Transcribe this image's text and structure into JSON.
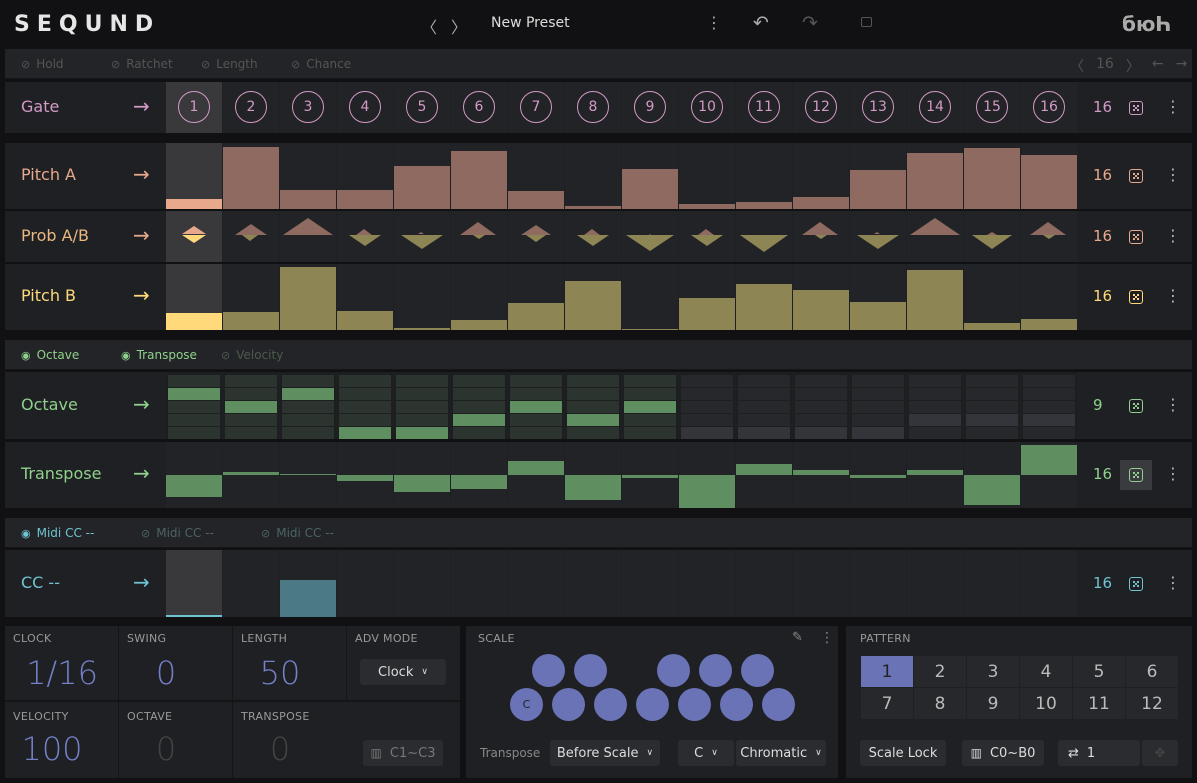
{
  "header": {
    "logo": "SEQUND",
    "prev_icon": "chevron-left-icon",
    "next_icon": "chevron-right-icon",
    "preset": "New Preset",
    "brand": "бюҺ"
  },
  "colors": {
    "gate": "#d39ac6",
    "pitch_a": "#e8a88c",
    "pitch_a_bar": "#8f6a60",
    "pitch_b": "#ffd97a",
    "pitch_b_bar": "#8e8555",
    "green": "#8fd18c",
    "green_bar": "#5f8e61",
    "cc": "#6fc4d2",
    "cc_bar": "#4b7a86",
    "accent": "#6a73b6"
  },
  "section1": {
    "tabs": [
      {
        "label": "Hold",
        "visible": false
      },
      {
        "label": "Ratchet",
        "visible": false
      },
      {
        "label": "Length",
        "visible": false
      },
      {
        "label": "Chance",
        "visible": false
      }
    ],
    "nav": {
      "length": "16"
    }
  },
  "gate": {
    "label": "Gate",
    "count": "16",
    "steps": [
      "1",
      "2",
      "3",
      "4",
      "5",
      "6",
      "7",
      "8",
      "9",
      "10",
      "11",
      "12",
      "13",
      "14",
      "15",
      "16"
    ]
  },
  "pitch_a": {
    "label": "Pitch A",
    "count": "16",
    "values": [
      15,
      94,
      29,
      29,
      65,
      88,
      27,
      5,
      61,
      8,
      11,
      18,
      59,
      85,
      92,
      82
    ]
  },
  "prob_ab": {
    "label": "Prob A/B",
    "count": "16",
    "prob_a": [
      50,
      65,
      100,
      35,
      15,
      75,
      60,
      35,
      3,
      35,
      2,
      75,
      15,
      100,
      20,
      75
    ]
  },
  "pitch_b": {
    "label": "Pitch B",
    "count": "16",
    "values": [
      26,
      27,
      95,
      29,
      3,
      15,
      41,
      74,
      2,
      48,
      70,
      61,
      42,
      91,
      11,
      17
    ]
  },
  "section2": {
    "tabs": [
      {
        "label": "Octave",
        "visible": true
      },
      {
        "label": "Transpose",
        "visible": true
      },
      {
        "label": "Velocity",
        "visible": false
      }
    ]
  },
  "octave": {
    "label": "Octave",
    "count": "9",
    "values": [
      1,
      0,
      1,
      -2,
      -2,
      -1,
      0,
      -1,
      0,
      -2,
      -2,
      -2,
      -2,
      -1,
      -1,
      -1
    ]
  },
  "transpose": {
    "label": "Transpose",
    "count": "16",
    "values": [
      -8,
      1,
      0,
      -2,
      -6,
      -5,
      5,
      -9,
      -1,
      -12,
      4,
      2,
      -1,
      2,
      -11,
      11
    ]
  },
  "section3": {
    "tabs": [
      {
        "label": "Midi CC --",
        "visible": true
      },
      {
        "label": "Midi CC --",
        "visible": false
      },
      {
        "label": "Midi CC --",
        "visible": false
      }
    ]
  },
  "cc": {
    "label": "CC --",
    "count": "16",
    "values": [
      0,
      0,
      55,
      0,
      0,
      0,
      0,
      0,
      0,
      0,
      0,
      0,
      0,
      0,
      0,
      0
    ]
  },
  "settings": {
    "clock_label": "CLOCK",
    "clock": "1/16",
    "swing_label": "SWING",
    "swing": "0",
    "length_label": "LENGTH",
    "length": "50",
    "adv_label": "ADV MODE",
    "adv": "Clock",
    "velocity_label": "VELOCITY",
    "velocity": "100",
    "octave_label": "OCTAVE",
    "octave": "0",
    "transpose_label": "TRANSPOSE",
    "transpose": "0",
    "range": "C1~C3"
  },
  "scale": {
    "label": "SCALE",
    "root_note": "C",
    "transpose_label": "Transpose",
    "transpose_mode": "Before Scale",
    "key": "C",
    "scale": "Chromatic"
  },
  "pattern": {
    "label": "PATTERN",
    "items": [
      "1",
      "2",
      "3",
      "4",
      "5",
      "6",
      "7",
      "8",
      "9",
      "10",
      "11",
      "12"
    ],
    "selected": "1",
    "scale_lock": "Scale Lock",
    "range": "C0~B0",
    "repeat": "1"
  }
}
